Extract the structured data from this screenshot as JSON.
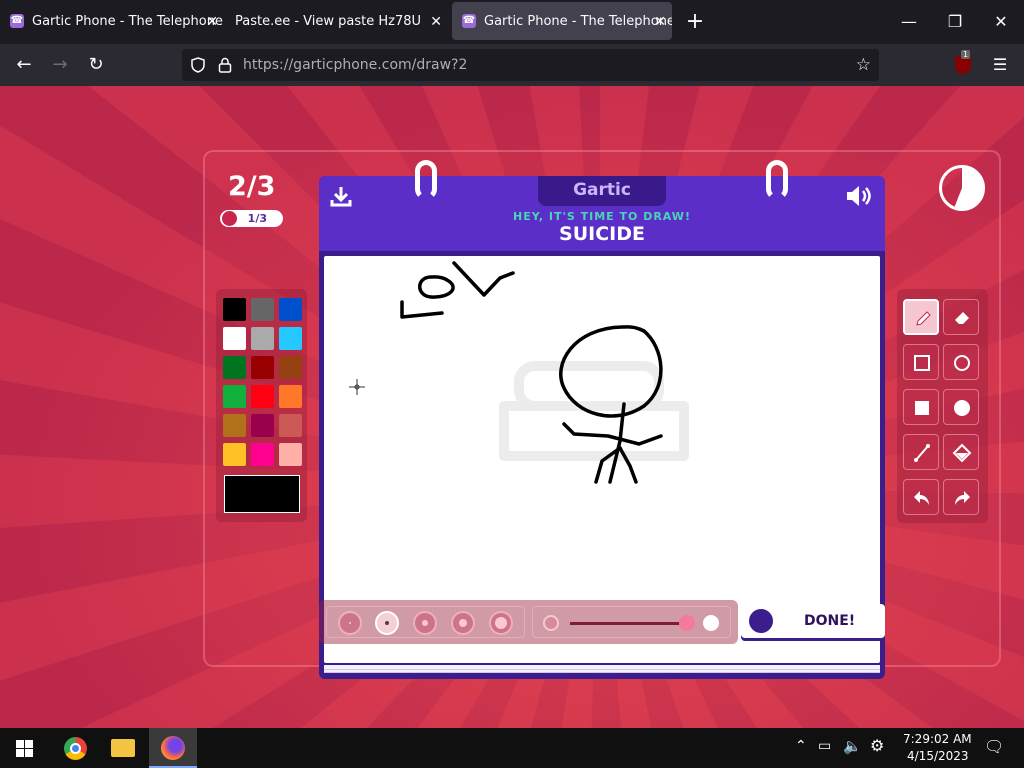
{
  "browser": {
    "tabs": [
      {
        "title": "Gartic Phone - The Telephone G",
        "icon": "phone-icon"
      },
      {
        "title": "Paste.ee - View paste Hz78U",
        "icon": ""
      },
      {
        "title": "Gartic Phone - The Telephone G",
        "icon": "phone-icon"
      }
    ],
    "url": "https://garticphone.com/draw?2",
    "extension_badge": "1"
  },
  "game": {
    "round": "2/3",
    "done_count": "1/3",
    "logo": "Gartic",
    "prompt_label": "HEY, IT'S TIME TO DRAW!",
    "word": "SUICIDE",
    "done_button": "DONE!",
    "timer_fraction_remaining": 0.56
  },
  "palette": {
    "colors": [
      "#000000",
      "#666666",
      "#0050cd",
      "#ffffff",
      "#aaaaaa",
      "#26c9ff",
      "#017420",
      "#990000",
      "#964112",
      "#11b03c",
      "#ff0013",
      "#ff7829",
      "#b0701c",
      "#99004e",
      "#cb5a57",
      "#ffc126",
      "#ff008f",
      "#feafa8"
    ],
    "current": "#000000"
  },
  "tools": [
    "pencil-icon",
    "eraser-icon",
    "rectangle-icon",
    "ellipse-icon",
    "filled-rectangle-icon",
    "filled-ellipse-icon",
    "line-icon",
    "fill-bucket-icon",
    "undo-icon",
    "redo-icon"
  ],
  "taskbar": {
    "time": "7:29:02 AM",
    "date": "4/15/2023"
  }
}
